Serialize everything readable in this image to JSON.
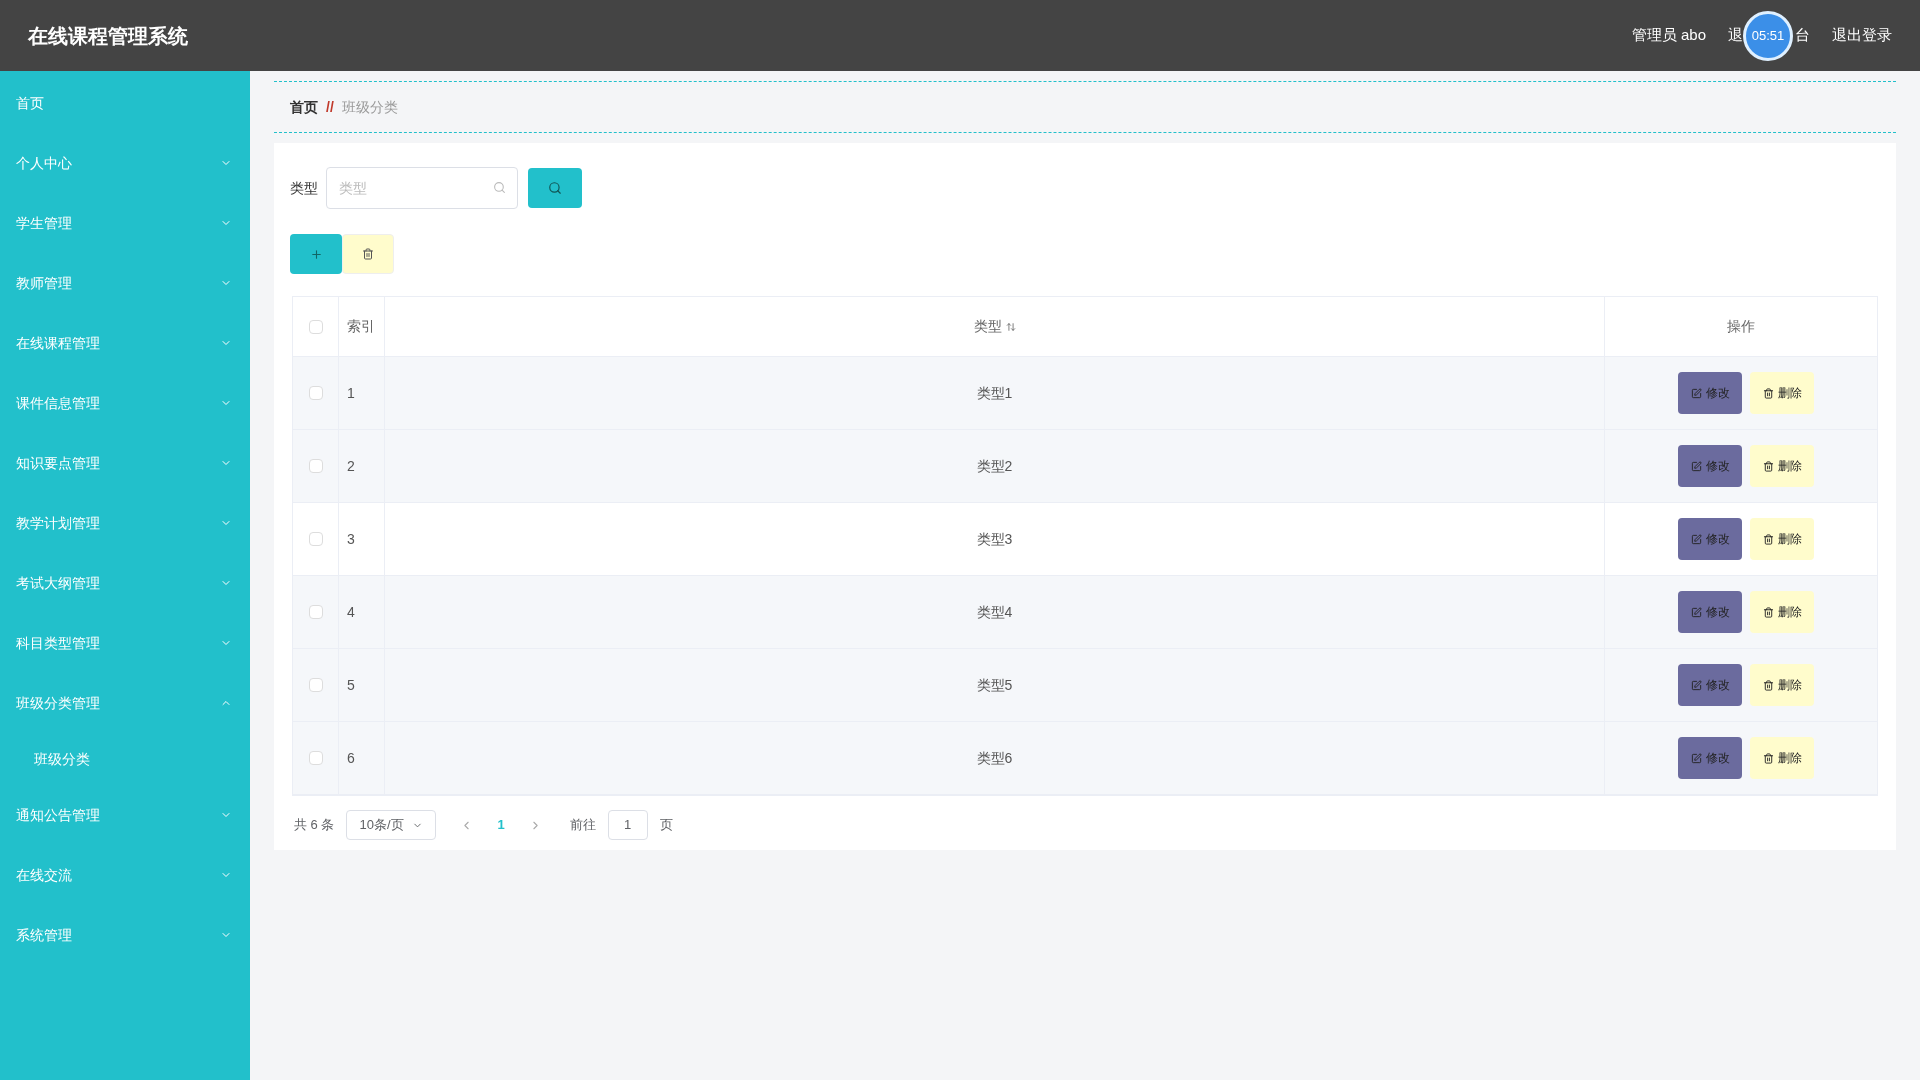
{
  "header": {
    "title": "在线课程管理系统",
    "user": "管理员 abo",
    "front_link_parts": [
      "退",
      "台"
    ],
    "logout": "退出登录",
    "timer": "05:51"
  },
  "sidebar": {
    "items": [
      {
        "label": "首页"
      },
      {
        "label": "个人中心",
        "expanded": false
      },
      {
        "label": "学生管理",
        "expanded": false
      },
      {
        "label": "教师管理",
        "expanded": false
      },
      {
        "label": "在线课程管理",
        "expanded": false
      },
      {
        "label": "课件信息管理",
        "expanded": false
      },
      {
        "label": "知识要点管理",
        "expanded": false
      },
      {
        "label": "教学计划管理",
        "expanded": false
      },
      {
        "label": "考试大纲管理",
        "expanded": false
      },
      {
        "label": "科目类型管理",
        "expanded": false
      },
      {
        "label": "班级分类管理",
        "expanded": true,
        "children": [
          {
            "label": "班级分类"
          }
        ]
      },
      {
        "label": "通知公告管理",
        "expanded": false
      },
      {
        "label": "在线交流",
        "expanded": false
      },
      {
        "label": "系统管理",
        "expanded": false
      }
    ]
  },
  "breadcrumb": {
    "items": [
      "首页",
      "班级分类"
    ],
    "separator": "//"
  },
  "search": {
    "label": "类型",
    "placeholder": "类型"
  },
  "table": {
    "columns": [
      "索引",
      "类型",
      "操作"
    ],
    "all_checked": false,
    "rows": [
      {
        "index": "1",
        "type": "类型1",
        "checked": false,
        "edit": "修改",
        "delete": "删除"
      },
      {
        "index": "2",
        "type": "类型2",
        "checked": false,
        "edit": "修改",
        "delete": "删除"
      },
      {
        "index": "3",
        "type": "类型3",
        "checked": false,
        "edit": "修改",
        "delete": "删除"
      },
      {
        "index": "4",
        "type": "类型4",
        "checked": false,
        "edit": "修改",
        "delete": "删除"
      },
      {
        "index": "5",
        "type": "类型5",
        "checked": false,
        "edit": "修改",
        "delete": "删除"
      },
      {
        "index": "6",
        "type": "类型6",
        "checked": false,
        "edit": "修改",
        "delete": "删除"
      }
    ]
  },
  "pagination": {
    "total": "共 6 条",
    "page_size": "10条/页",
    "pages": [
      {
        "label": "1",
        "selected": true
      }
    ],
    "goto": "前往",
    "goto_value": "1",
    "page_unit": "页"
  }
}
